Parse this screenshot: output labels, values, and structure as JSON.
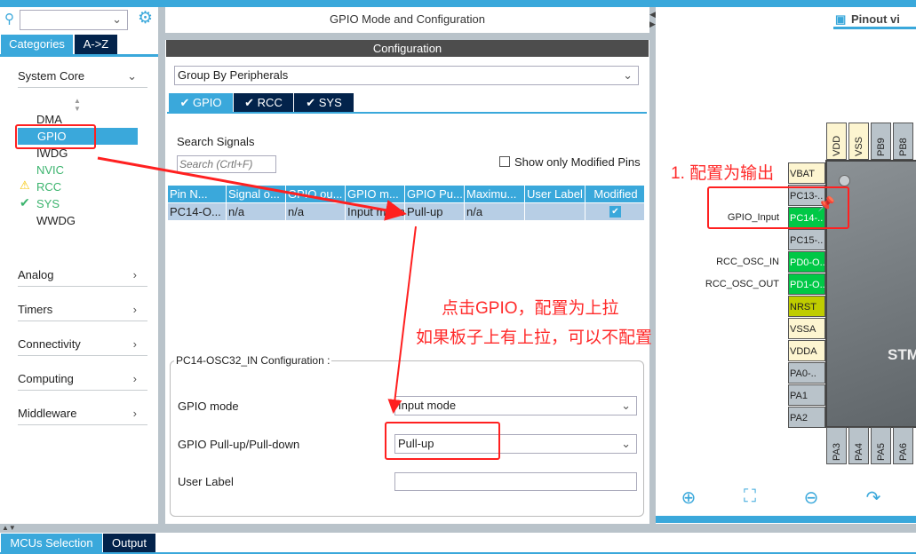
{
  "left_panel": {
    "search_placeholder": "",
    "tabs": [
      {
        "label": "Categories",
        "active": true
      },
      {
        "label": "A->Z",
        "active": false
      }
    ],
    "system_core": {
      "label": "System Core",
      "items": [
        {
          "label": "DMA",
          "status": "none"
        },
        {
          "label": "GPIO",
          "status": "selected"
        },
        {
          "label": "IWDG",
          "status": "none"
        },
        {
          "label": "NVIC",
          "status": "configured"
        },
        {
          "label": "RCC",
          "status": "warning"
        },
        {
          "label": "SYS",
          "status": "ok"
        },
        {
          "label": "WWDG",
          "status": "none"
        }
      ]
    },
    "categories": [
      "Analog",
      "Timers",
      "Connectivity",
      "Computing",
      "Middleware"
    ]
  },
  "middle": {
    "title": "GPIO Mode and Configuration",
    "config_header": "Configuration",
    "group_by": "Group By Peripherals",
    "tabs": [
      {
        "label": "GPIO",
        "active": true
      },
      {
        "label": "RCC"
      },
      {
        "label": "SYS"
      }
    ],
    "search_label": "Search Signals",
    "search_placeholder": "Search (Crtl+F)",
    "show_modified_label": "Show only Modified Pins",
    "show_modified_checked": false,
    "table": {
      "headers": [
        "Pin N...",
        "Signal o...",
        "GPIO ou...",
        "GPIO m...",
        "GPIO Pu...",
        "Maximu...",
        "User Label",
        "Modified"
      ],
      "rows": [
        [
          "PC14-O...",
          "n/a",
          "n/a",
          "Input mode",
          "Pull-up",
          "n/a",
          "",
          true
        ]
      ]
    },
    "pin_config": {
      "legend": "PC14-OSC32_IN Configuration :",
      "gpio_mode_label": "GPIO mode",
      "gpio_mode_value": "Input mode",
      "pull_label": "GPIO Pull-up/Pull-down",
      "pull_value": "Pull-up",
      "user_label_label": "User Label",
      "user_label_value": ""
    }
  },
  "right": {
    "tab_label": "Pinout vi",
    "left_pins": [
      {
        "name": "VBAT",
        "color": "cream",
        "signal": ""
      },
      {
        "name": "PC13-..",
        "color": "grey",
        "signal": ""
      },
      {
        "name": "PC14-..",
        "color": "green",
        "signal": "GPIO_Input"
      },
      {
        "name": "PC15-..",
        "color": "grey",
        "signal": ""
      },
      {
        "name": "PD0-O..",
        "color": "green",
        "signal": "RCC_OSC_IN"
      },
      {
        "name": "PD1-O..",
        "color": "green",
        "signal": "RCC_OSC_OUT"
      },
      {
        "name": "NRST",
        "color": "olive",
        "signal": ""
      },
      {
        "name": "VSSA",
        "color": "cream",
        "signal": ""
      },
      {
        "name": "VDDA",
        "color": "cream",
        "signal": ""
      },
      {
        "name": "PA0-..",
        "color": "grey",
        "signal": ""
      },
      {
        "name": "PA1",
        "color": "grey",
        "signal": ""
      },
      {
        "name": "PA2",
        "color": "grey",
        "signal": ""
      }
    ],
    "top_pins": [
      {
        "name": "VDD",
        "color": "cream"
      },
      {
        "name": "VSS",
        "color": "cream"
      },
      {
        "name": "PB9",
        "color": "grey"
      },
      {
        "name": "PB8",
        "color": "grey"
      }
    ],
    "bottom_pins": [
      {
        "name": "PA3"
      },
      {
        "name": "PA4"
      },
      {
        "name": "PA5"
      },
      {
        "name": "PA6"
      }
    ],
    "chip_text": "STM",
    "tools": [
      "zoom-in-icon",
      "fit-icon",
      "zoom-out-icon",
      "rotate-icon"
    ]
  },
  "bottom_tabs": [
    {
      "label": "MCUs Selection",
      "active": true
    },
    {
      "label": "Output"
    }
  ],
  "annotations": {
    "step1": "1. 配置为输出",
    "note_line1": "点击GPIO，配置为上拉",
    "note_line2": "如果板子上有上拉，可以不配置"
  },
  "colors": {
    "accent": "#3aa8db",
    "navy": "#03234b",
    "annotation": "#ff2020",
    "pin_green": "#00c846"
  }
}
